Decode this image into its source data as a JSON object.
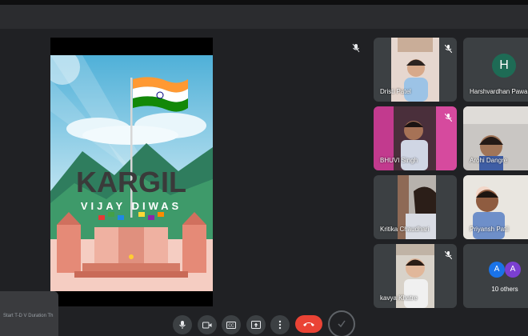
{
  "presentation": {
    "poster_title": "KARGIL",
    "poster_subtitle": "VIJAY DIWAS",
    "nav_glyphs": [
      "|||",
      "○",
      "‹"
    ]
  },
  "participants": [
    {
      "name": "Dristi Patel",
      "muted": true
    },
    {
      "name": "Harshvardhan Pawar",
      "muted": false,
      "avatar_letter": "H",
      "avatar_color": "#1e6b55"
    },
    {
      "name": "BHUVI Singh",
      "muted": true
    },
    {
      "name": "Arohi Dangre",
      "muted": false
    },
    {
      "name": "Kritika Chaudhari",
      "muted": false
    },
    {
      "name": "Priyansh Patil",
      "muted": false
    },
    {
      "name": "kavya Khatre",
      "muted": true
    }
  ],
  "others": {
    "label": "10 others",
    "letters": [
      "A",
      "A"
    ],
    "colors": [
      "#1a73e8",
      "#7b3fd1"
    ]
  },
  "popup": {
    "text": "Start T-D V Duration Th"
  },
  "colors": {
    "background": "#202124",
    "tile": "#3c4043",
    "end_call": "#ea4335"
  }
}
